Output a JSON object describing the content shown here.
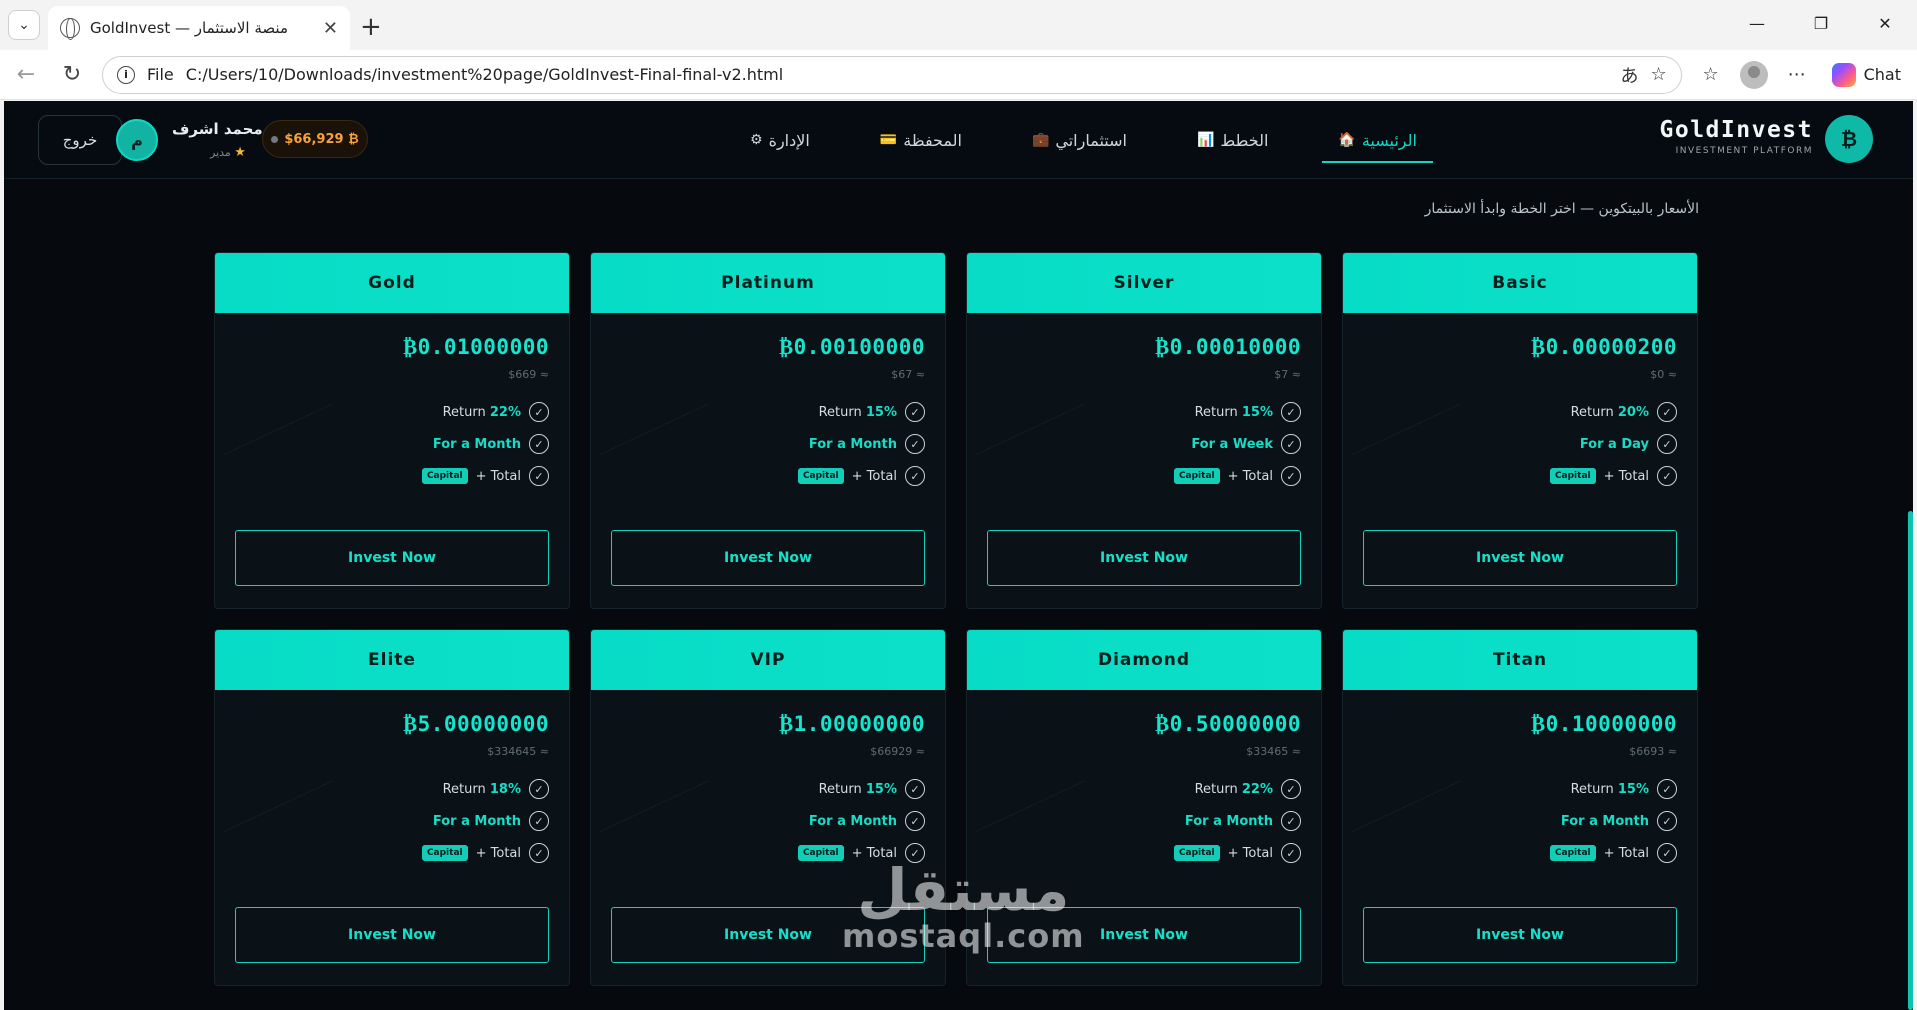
{
  "browser": {
    "tab_title": "GoldInvest — منصة الاستثمار",
    "url_scheme": "File",
    "url_path": "C:/Users/10/Downloads/investment%20page/GoldInvest-Final-final-v2.html",
    "chat_label": "Chat"
  },
  "header": {
    "logout_label": "خروج",
    "avatar_initial": "م",
    "user_name": "محمد اشرف",
    "user_role": "مدير",
    "btc_price": "$66,929 ₿",
    "nav": [
      {
        "label": "الإدارة",
        "icon": "⚙"
      },
      {
        "label": "المحفظة",
        "icon": "💳"
      },
      {
        "label": "استثماراتي",
        "icon": "💼"
      },
      {
        "label": "الخطط",
        "icon": "📊"
      },
      {
        "label": "الرئيسية",
        "icon": "🏠"
      }
    ],
    "brand_name": "GoldInvest",
    "brand_sub": "INVESTMENT PLATFORM",
    "brand_logo": "₿"
  },
  "section": {
    "subtitle": "الأسعار بالبيتكوين — اختر الخطة وابدأ الاستثمار"
  },
  "plans": [
    {
      "name": "Gold",
      "price": "₿0.01000000",
      "usd": "$669 ≈",
      "return_label": "Return",
      "return_value": "22%",
      "duration": "For a Month",
      "capital": "Capital",
      "total": "+ Total",
      "cta": "Invest Now"
    },
    {
      "name": "Platinum",
      "price": "₿0.00100000",
      "usd": "$67 ≈",
      "return_label": "Return",
      "return_value": "15%",
      "duration": "For a Month",
      "capital": "Capital",
      "total": "+ Total",
      "cta": "Invest Now"
    },
    {
      "name": "Silver",
      "price": "₿0.00010000",
      "usd": "$7 ≈",
      "return_label": "Return",
      "return_value": "15%",
      "duration": "For a Week",
      "capital": "Capital",
      "total": "+ Total",
      "cta": "Invest Now"
    },
    {
      "name": "Basic",
      "price": "₿0.00000200",
      "usd": "$0 ≈",
      "return_label": "Return",
      "return_value": "20%",
      "duration": "For a Day",
      "capital": "Capital",
      "total": "+ Total",
      "cta": "Invest Now"
    },
    {
      "name": "Elite",
      "price": "₿5.00000000",
      "usd": "$334645 ≈",
      "return_label": "Return",
      "return_value": "18%",
      "duration": "For a Month",
      "capital": "Capital",
      "total": "+ Total",
      "cta": "Invest Now"
    },
    {
      "name": "VIP",
      "price": "₿1.00000000",
      "usd": "$66929 ≈",
      "return_label": "Return",
      "return_value": "15%",
      "duration": "For a Month",
      "capital": "Capital",
      "total": "+ Total",
      "cta": "Invest Now"
    },
    {
      "name": "Diamond",
      "price": "₿0.50000000",
      "usd": "$33465 ≈",
      "return_label": "Return",
      "return_value": "22%",
      "duration": "For a Month",
      "capital": "Capital",
      "total": "+ Total",
      "cta": "Invest Now"
    },
    {
      "name": "Titan",
      "price": "₿0.10000000",
      "usd": "$6693 ≈",
      "return_label": "Return",
      "return_value": "15%",
      "duration": "For a Month",
      "capital": "Capital",
      "total": "+ Total",
      "cta": "Invest Now"
    }
  ],
  "watermark": {
    "arabic": "مستقل",
    "latin": "mostaql.com"
  },
  "colors": {
    "accent": "#10d6c3",
    "background": "#06090e",
    "bitcoin": "#f7a23b"
  }
}
